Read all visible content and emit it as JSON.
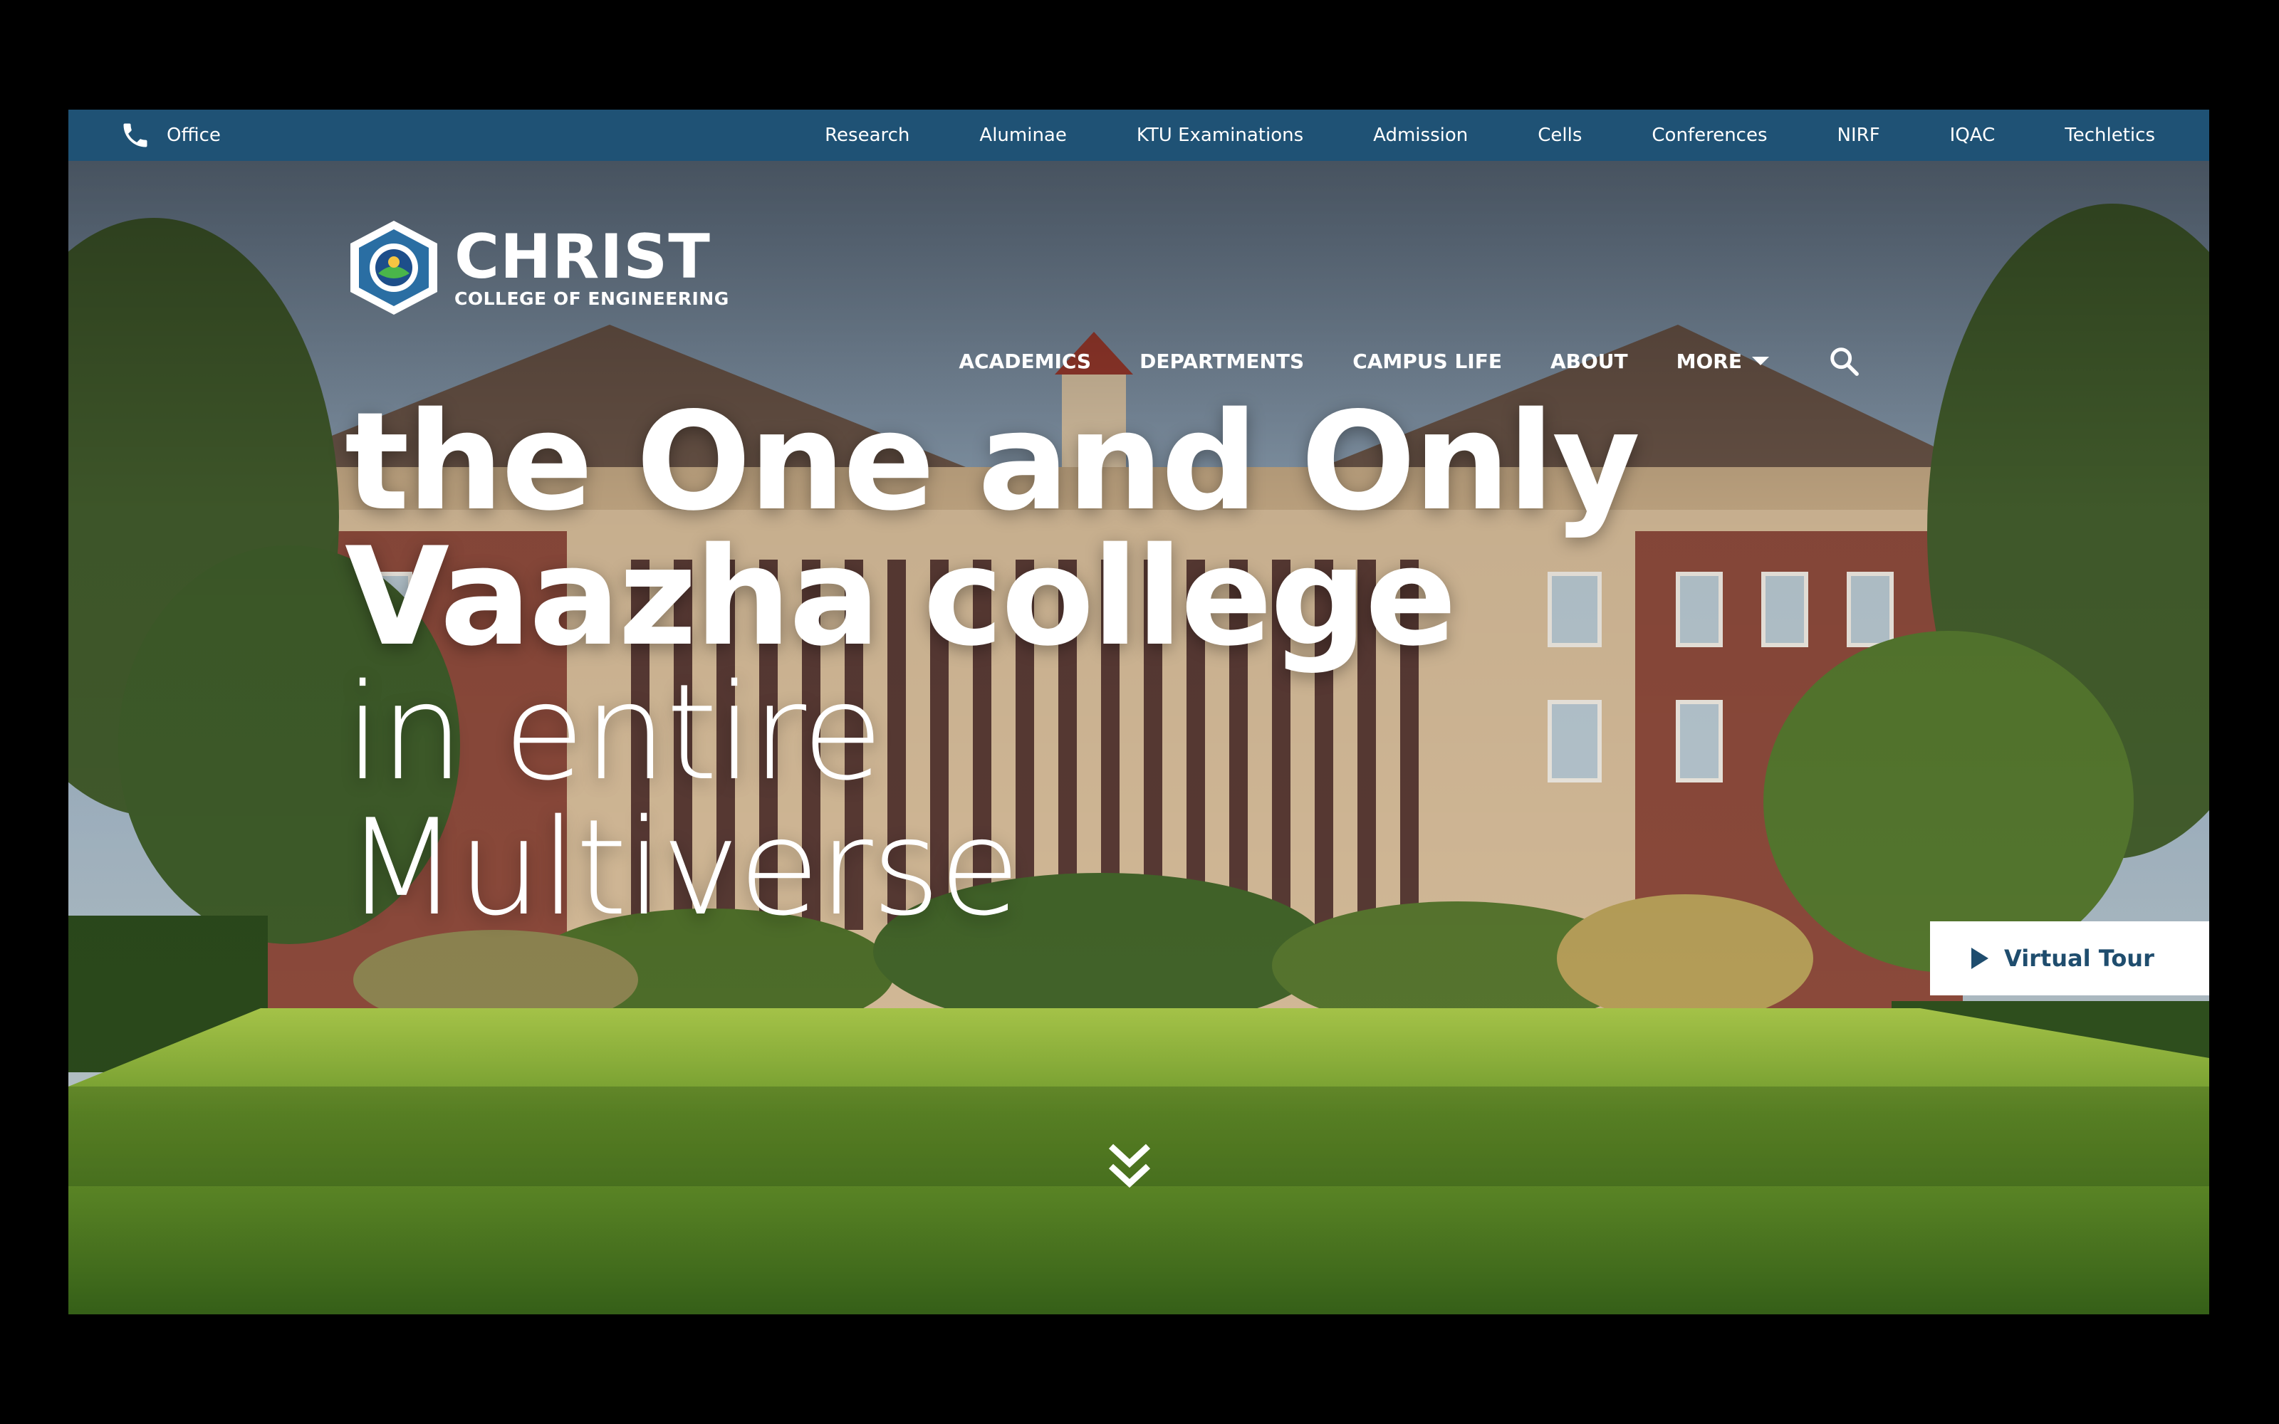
{
  "topbar": {
    "office_label": "Office",
    "links": [
      "Research",
      "Aluminae",
      "KTU Examinations",
      "Admission",
      "Cells",
      "Conferences",
      "NIRF",
      "IQAC",
      "Techletics"
    ]
  },
  "brand": {
    "name": "CHRIST",
    "subtitle": "COLLEGE OF ENGINEERING"
  },
  "nav": {
    "items": [
      "ACADEMICS",
      "DEPARTMENTS",
      "CAMPUS LIFE",
      "ABOUT"
    ],
    "more_label": "MORE"
  },
  "hero": {
    "line1": "the One and Only",
    "line2": "Vaazha college",
    "line3": "in entire",
    "line4": "Multiverse"
  },
  "tour": {
    "label": "Virtual Tour"
  },
  "icons": {
    "phone": "phone-icon",
    "search": "search-icon",
    "caret": "caret-down-icon",
    "play": "play-icon",
    "scroll": "double-chevron-down-icon"
  },
  "colors": {
    "topbar": "#1f5275",
    "accent": "#1f4d6e",
    "text": "#ffffff"
  }
}
